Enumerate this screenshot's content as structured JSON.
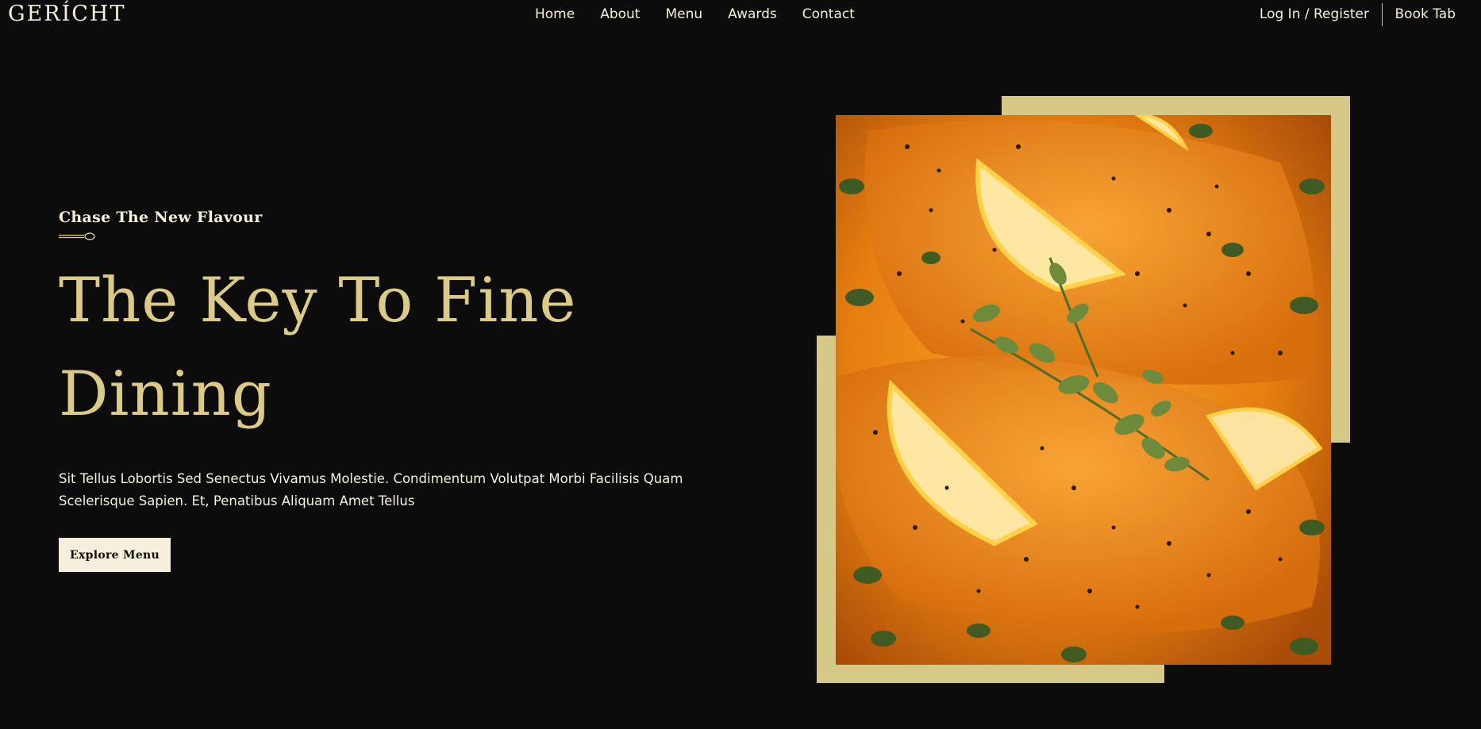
{
  "logo": {
    "text": "GERÍCHT"
  },
  "nav": {
    "links": [
      {
        "label": "Home"
      },
      {
        "label": "About"
      },
      {
        "label": "Menu"
      },
      {
        "label": "Awards"
      },
      {
        "label": "Contact"
      }
    ],
    "login_label": "Log In / Register",
    "book_label": "Book Tab"
  },
  "hero": {
    "subtitle": "Chase The New Flavour",
    "headline_line1": "The Key To Fine",
    "headline_line2": "Dining",
    "description": "Sit Tellus Lobortis Sed Senectus Vivamus Molestie. Condimentum Volutpat Morbi Facilisis Quam Scelerisque Sapien. Et, Penatibus Aliquam Amet Tellus",
    "button_label": "Explore Menu"
  },
  "colors": {
    "background": "#0c0c0c",
    "gold": "#dcca87",
    "cream": "#f5efdb",
    "frame_gold": "#d6c886"
  },
  "icons": {
    "spoon": "spoon-icon"
  }
}
